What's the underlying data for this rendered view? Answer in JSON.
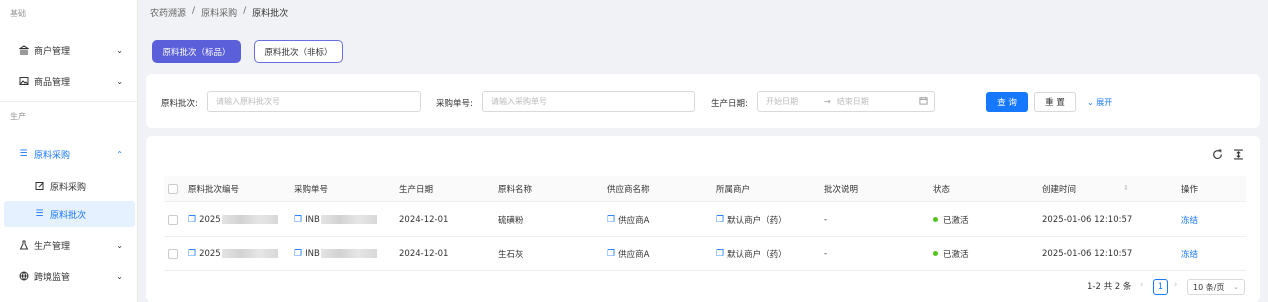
{
  "sidebar": {
    "section_base": "基础",
    "section_prod": "生产",
    "items": [
      {
        "icon": "bank-icon",
        "label": "商户管理"
      },
      {
        "icon": "image-icon",
        "label": "商品管理"
      },
      {
        "icon": "list-icon",
        "label": "原料采购"
      },
      {
        "icon": "edit-icon",
        "label": "原料采购"
      },
      {
        "icon": "list-icon",
        "label": "原料批次"
      },
      {
        "icon": "flask-icon",
        "label": "生产管理"
      },
      {
        "icon": "globe-icon",
        "label": "跨境监管"
      }
    ]
  },
  "breadcrumb": [
    "农药溯源",
    "原料采购",
    "原料批次"
  ],
  "tabs": [
    "原料批次（标品）",
    "原料批次（非标）"
  ],
  "filter": {
    "batch_label": "原料批次:",
    "batch_placeholder": "请输入原料批次号",
    "order_label": "采购单号:",
    "order_placeholder": "请输入采购单号",
    "date_label": "生产日期:",
    "date_start": "开始日期",
    "date_end": "结束日期",
    "query": "查 询",
    "reset": "重 置",
    "expand": "展开"
  },
  "table": {
    "headers": [
      "原料批次编号",
      "采购单号",
      "生产日期",
      "原料名称",
      "供应商名称",
      "所属商户",
      "批次说明",
      "状态",
      "创建时间",
      "操作"
    ],
    "rows": [
      {
        "batch": "2025",
        "order": "INB",
        "date": "2024-12-01",
        "material": "硫磺粉",
        "supplier": "供应商A",
        "merchant": "默认商户（药）",
        "desc": "-",
        "status": "已激活",
        "created": "2025-01-06 12:10:57",
        "action": "冻结"
      },
      {
        "batch": "2025",
        "order": "INB",
        "date": "2024-12-01",
        "material": "生石灰",
        "supplier": "供应商A",
        "merchant": "默认商户（药）",
        "desc": "-",
        "status": "已激活",
        "created": "2025-01-06 12:10:57",
        "action": "冻结"
      }
    ]
  },
  "pagination": {
    "summary": "1-2 共 2 条",
    "page": "1",
    "size": "10 条/页"
  },
  "colors": {
    "primary": "#1677ff",
    "tab_active": "#5b5fd9",
    "status_green": "#52c41a"
  }
}
